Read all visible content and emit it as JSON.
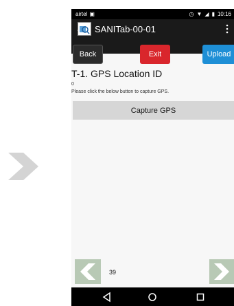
{
  "status_bar": {
    "carrier": "airtel",
    "time": "10:16",
    "icons": [
      "image-icon",
      "alarm-icon",
      "wifi-icon",
      "signal-icon",
      "battery-icon"
    ]
  },
  "app_bar": {
    "title": "SANITab-00-01",
    "logo_icon": "app-logo-icon",
    "menu_icon": "overflow-menu-icon"
  },
  "toolbar": {
    "back_label": "Back",
    "exit_label": "Exit",
    "upload_label": "Upload"
  },
  "form": {
    "title": "T-1. GPS Location ID",
    "value": "0",
    "hint": "Please click the below button to capture GPS.",
    "capture_label": "Capture GPS"
  },
  "pager": {
    "page_number": "39",
    "prev_icon": "chevron-left-icon",
    "next_icon": "chevron-right-icon"
  },
  "system_nav": {
    "icons": [
      "back-triangle-icon",
      "home-circle-icon",
      "recents-square-icon"
    ]
  },
  "colors": {
    "exit": "#d9262c",
    "upload": "#1e8fd6",
    "back": "#2b2b2b",
    "capture": "#d6d6d6",
    "pager_bg": "#b8c9b5"
  }
}
